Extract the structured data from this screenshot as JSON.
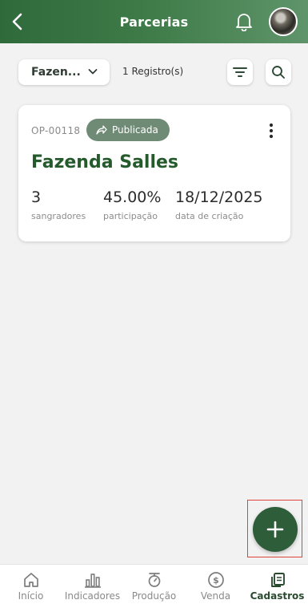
{
  "header": {
    "title": "Parcerias",
    "back_icon": "chevron-left-icon",
    "bell_icon": "bell-icon"
  },
  "filters": {
    "dropdown_value": "Fazen...",
    "record_count": "1 Registro(s)"
  },
  "card": {
    "code": "OP-00118",
    "status": "Publicada",
    "name": "Fazenda Salles",
    "stats": [
      {
        "value": "3",
        "label": "sangradores"
      },
      {
        "value": "45.00%",
        "label": "participação"
      },
      {
        "value": "18/12/2025",
        "label": "data de criação"
      }
    ]
  },
  "nav": {
    "items": [
      {
        "label": "Início",
        "icon": "home-icon"
      },
      {
        "label": "Indicadores",
        "icon": "bar-chart-icon"
      },
      {
        "label": "Produção",
        "icon": "scale-icon"
      },
      {
        "label": "Venda",
        "icon": "dollar-icon"
      },
      {
        "label": "Cadastros",
        "icon": "copy-icon",
        "active": true
      }
    ]
  },
  "colors": {
    "primary": "#2f6a3b",
    "fab": "#2e5e39",
    "badge": "#6f8a75",
    "farm_title": "#245a2c",
    "highlight": "#e0433d"
  }
}
